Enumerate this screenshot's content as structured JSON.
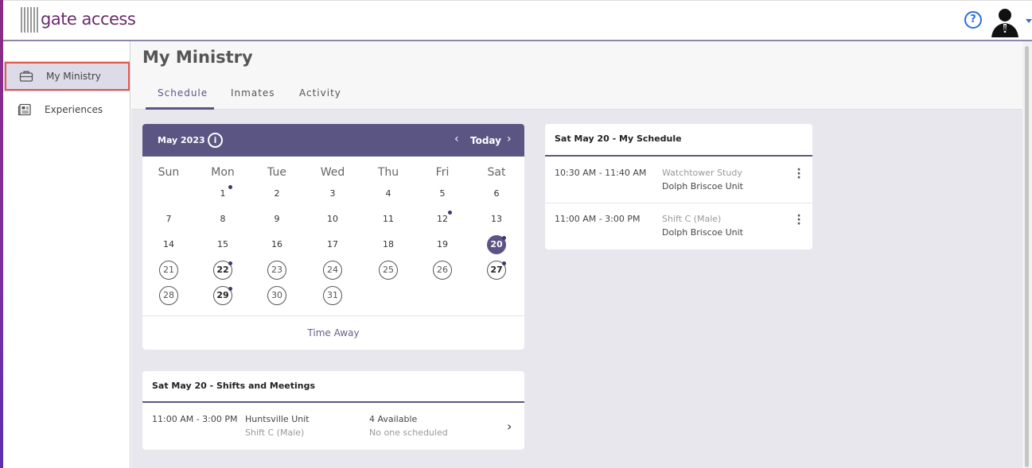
{
  "brand": {
    "logo_text": "gate access"
  },
  "topbar": {
    "help_icon": "question-circle-icon",
    "avatar_icon": "user-silhouette-icon"
  },
  "sidebar": {
    "items": [
      {
        "label": "My Ministry",
        "icon": "briefcase-icon",
        "active": true
      },
      {
        "label": "Experiences",
        "icon": "newspaper-icon",
        "active": false
      }
    ]
  },
  "page": {
    "title": "My Ministry",
    "tabs": [
      {
        "label": "Schedule",
        "active": true
      },
      {
        "label": "Inmates",
        "active": false
      },
      {
        "label": "Activity",
        "active": false
      }
    ]
  },
  "calendar": {
    "month_label": "May 2023",
    "today_label": "Today",
    "weekdays": [
      "Sun",
      "Mon",
      "Tue",
      "Wed",
      "Thu",
      "Fri",
      "Sat"
    ],
    "days": [
      {
        "d": "1",
        "dot": true
      },
      {
        "d": "2"
      },
      {
        "d": "3"
      },
      {
        "d": "4"
      },
      {
        "d": "5"
      },
      {
        "d": "6"
      },
      {
        "d": "7"
      },
      {
        "d": "8"
      },
      {
        "d": "9"
      },
      {
        "d": "10"
      },
      {
        "d": "11"
      },
      {
        "d": "12",
        "dot": true
      },
      {
        "d": "13"
      },
      {
        "d": "14"
      },
      {
        "d": "15"
      },
      {
        "d": "16"
      },
      {
        "d": "17"
      },
      {
        "d": "18"
      },
      {
        "d": "19"
      },
      {
        "d": "20",
        "selected": true,
        "dot": true
      },
      {
        "d": "21",
        "outline": true
      },
      {
        "d": "22",
        "outline": true,
        "bold": true,
        "dot": true
      },
      {
        "d": "23",
        "outline": true
      },
      {
        "d": "24",
        "outline": true
      },
      {
        "d": "25",
        "outline": true
      },
      {
        "d": "26",
        "outline": true
      },
      {
        "d": "27",
        "outline": true,
        "bold": true,
        "dot": true
      },
      {
        "d": "28",
        "outline": true
      },
      {
        "d": "29",
        "outline": true,
        "bold": true,
        "dot": true
      },
      {
        "d": "30",
        "outline": true
      },
      {
        "d": "31",
        "outline": true
      }
    ],
    "time_away_label": "Time Away"
  },
  "shifts_card": {
    "title": "Sat May 20 - Shifts and Meetings",
    "rows": [
      {
        "time": "11:00 AM - 3:00 PM",
        "unit": "Huntsville Unit",
        "shift": "Shift C (Male)",
        "available": "4 Available",
        "scheduled": "No one scheduled"
      }
    ]
  },
  "my_schedule": {
    "title": "Sat May 20 - My Schedule",
    "rows": [
      {
        "time": "10:30 AM - 11:40 AM",
        "activity": "Watchtower Study",
        "unit": "Dolph Briscoe Unit"
      },
      {
        "time": "11:00 AM - 3:00 PM",
        "activity": "Shift C (Male)",
        "unit": "Dolph Briscoe Unit"
      }
    ]
  },
  "colors": {
    "primary": "#5b5584",
    "accent_left": "#7a2fa0",
    "highlight": "#e35a4b"
  }
}
